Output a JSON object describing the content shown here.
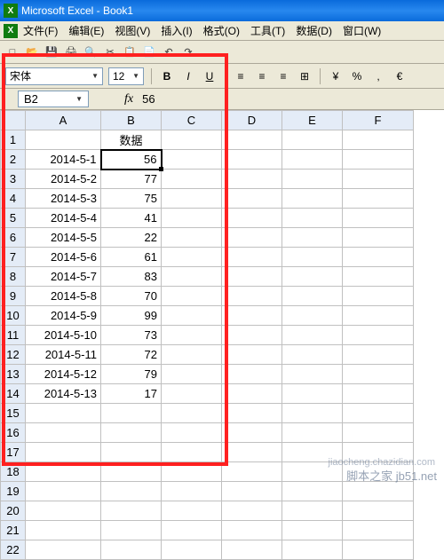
{
  "title": "Microsoft Excel - Book1",
  "menu": {
    "file": "文件(F)",
    "edit": "编辑(E)",
    "view": "视图(V)",
    "insert": "插入(I)",
    "format": "格式(O)",
    "tools": "工具(T)",
    "data": "数据(D)",
    "window": "窗口(W)"
  },
  "format_bar": {
    "font": "宋体",
    "size": "12",
    "bold": "B",
    "italic": "I",
    "underline": "U",
    "percent": "%",
    "comma": ",",
    "currency": "€"
  },
  "namebox": "B2",
  "fx_label": "fx",
  "formula_value": "56",
  "columns": [
    "A",
    "B",
    "C",
    "D",
    "E",
    "F"
  ],
  "header_b": "数据",
  "rows": [
    {
      "n": "1",
      "a": "",
      "b": "数据"
    },
    {
      "n": "2",
      "a": "2014-5-1",
      "b": "56"
    },
    {
      "n": "3",
      "a": "2014-5-2",
      "b": "77"
    },
    {
      "n": "4",
      "a": "2014-5-3",
      "b": "75"
    },
    {
      "n": "5",
      "a": "2014-5-4",
      "b": "41"
    },
    {
      "n": "6",
      "a": "2014-5-5",
      "b": "22"
    },
    {
      "n": "7",
      "a": "2014-5-6",
      "b": "61"
    },
    {
      "n": "8",
      "a": "2014-5-7",
      "b": "83"
    },
    {
      "n": "9",
      "a": "2014-5-8",
      "b": "70"
    },
    {
      "n": "10",
      "a": "2014-5-9",
      "b": "99"
    },
    {
      "n": "11",
      "a": "2014-5-10",
      "b": "73"
    },
    {
      "n": "12",
      "a": "2014-5-11",
      "b": "72"
    },
    {
      "n": "13",
      "a": "2014-5-12",
      "b": "79"
    },
    {
      "n": "14",
      "a": "2014-5-13",
      "b": "17"
    },
    {
      "n": "15",
      "a": "",
      "b": ""
    },
    {
      "n": "16",
      "a": "",
      "b": ""
    },
    {
      "n": "17",
      "a": "",
      "b": ""
    },
    {
      "n": "18",
      "a": "",
      "b": ""
    },
    {
      "n": "19",
      "a": "",
      "b": ""
    },
    {
      "n": "20",
      "a": "",
      "b": ""
    },
    {
      "n": "21",
      "a": "",
      "b": ""
    },
    {
      "n": "22",
      "a": "",
      "b": ""
    }
  ],
  "watermark": "脚本之家 jb51.net",
  "watermark2": "jiaocheng.chazidian.com"
}
